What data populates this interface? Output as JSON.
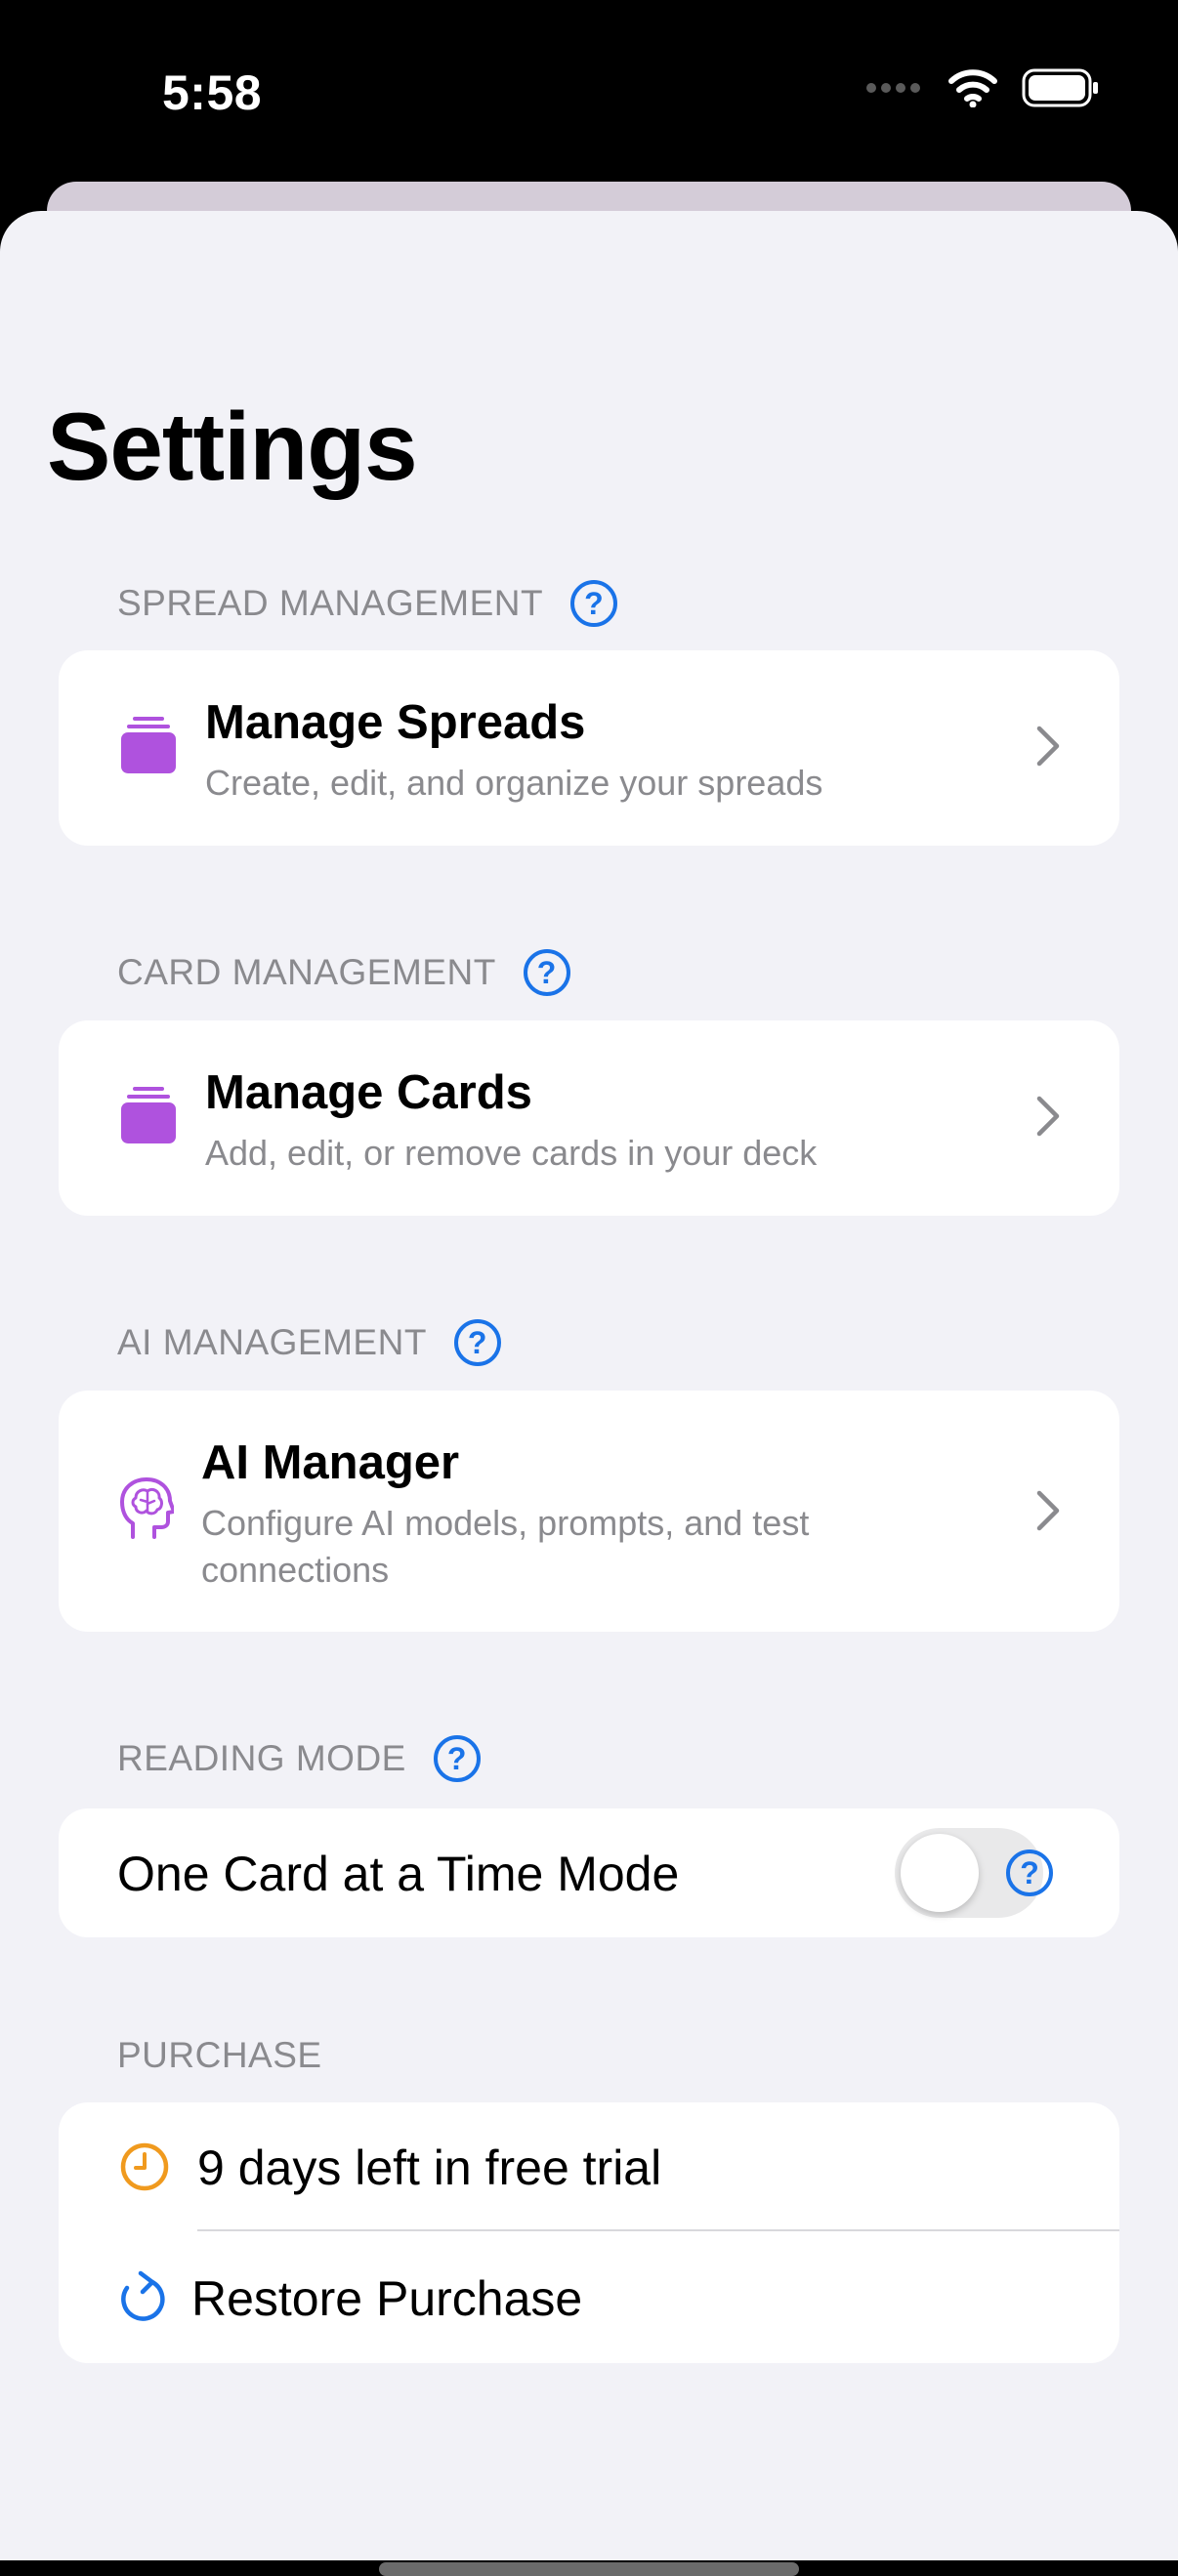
{
  "status_bar": {
    "time": "5:58"
  },
  "title": "Settings",
  "sections": {
    "spread": {
      "header": "SPREAD MANAGEMENT",
      "row": {
        "title": "Manage Spreads",
        "subtitle": "Create, edit, and organize your spreads",
        "icon": "stack-icon"
      }
    },
    "card": {
      "header": "CARD MANAGEMENT",
      "row": {
        "title": "Manage Cards",
        "subtitle": "Add, edit, or remove cards in your deck",
        "icon": "stack-icon"
      }
    },
    "ai": {
      "header": "AI MANAGEMENT",
      "row": {
        "title": "AI Manager",
        "subtitle_line1": "Configure AI models, prompts, and test",
        "subtitle_line2": "connections",
        "icon": "brain-head-icon"
      }
    },
    "reading": {
      "header": "READING MODE",
      "row": {
        "label": "One Card at a Time Mode",
        "toggle_on": false
      }
    },
    "purchase": {
      "header": "PURCHASE",
      "trial_text": "9 days left in free trial",
      "restore_text": "Restore Purchase"
    }
  },
  "help_glyph": "?",
  "colors": {
    "accent": "#1a73e8",
    "icon_purple": "#af52de",
    "trial_orange": "#f09a1e",
    "background": "#f2f2f7"
  }
}
